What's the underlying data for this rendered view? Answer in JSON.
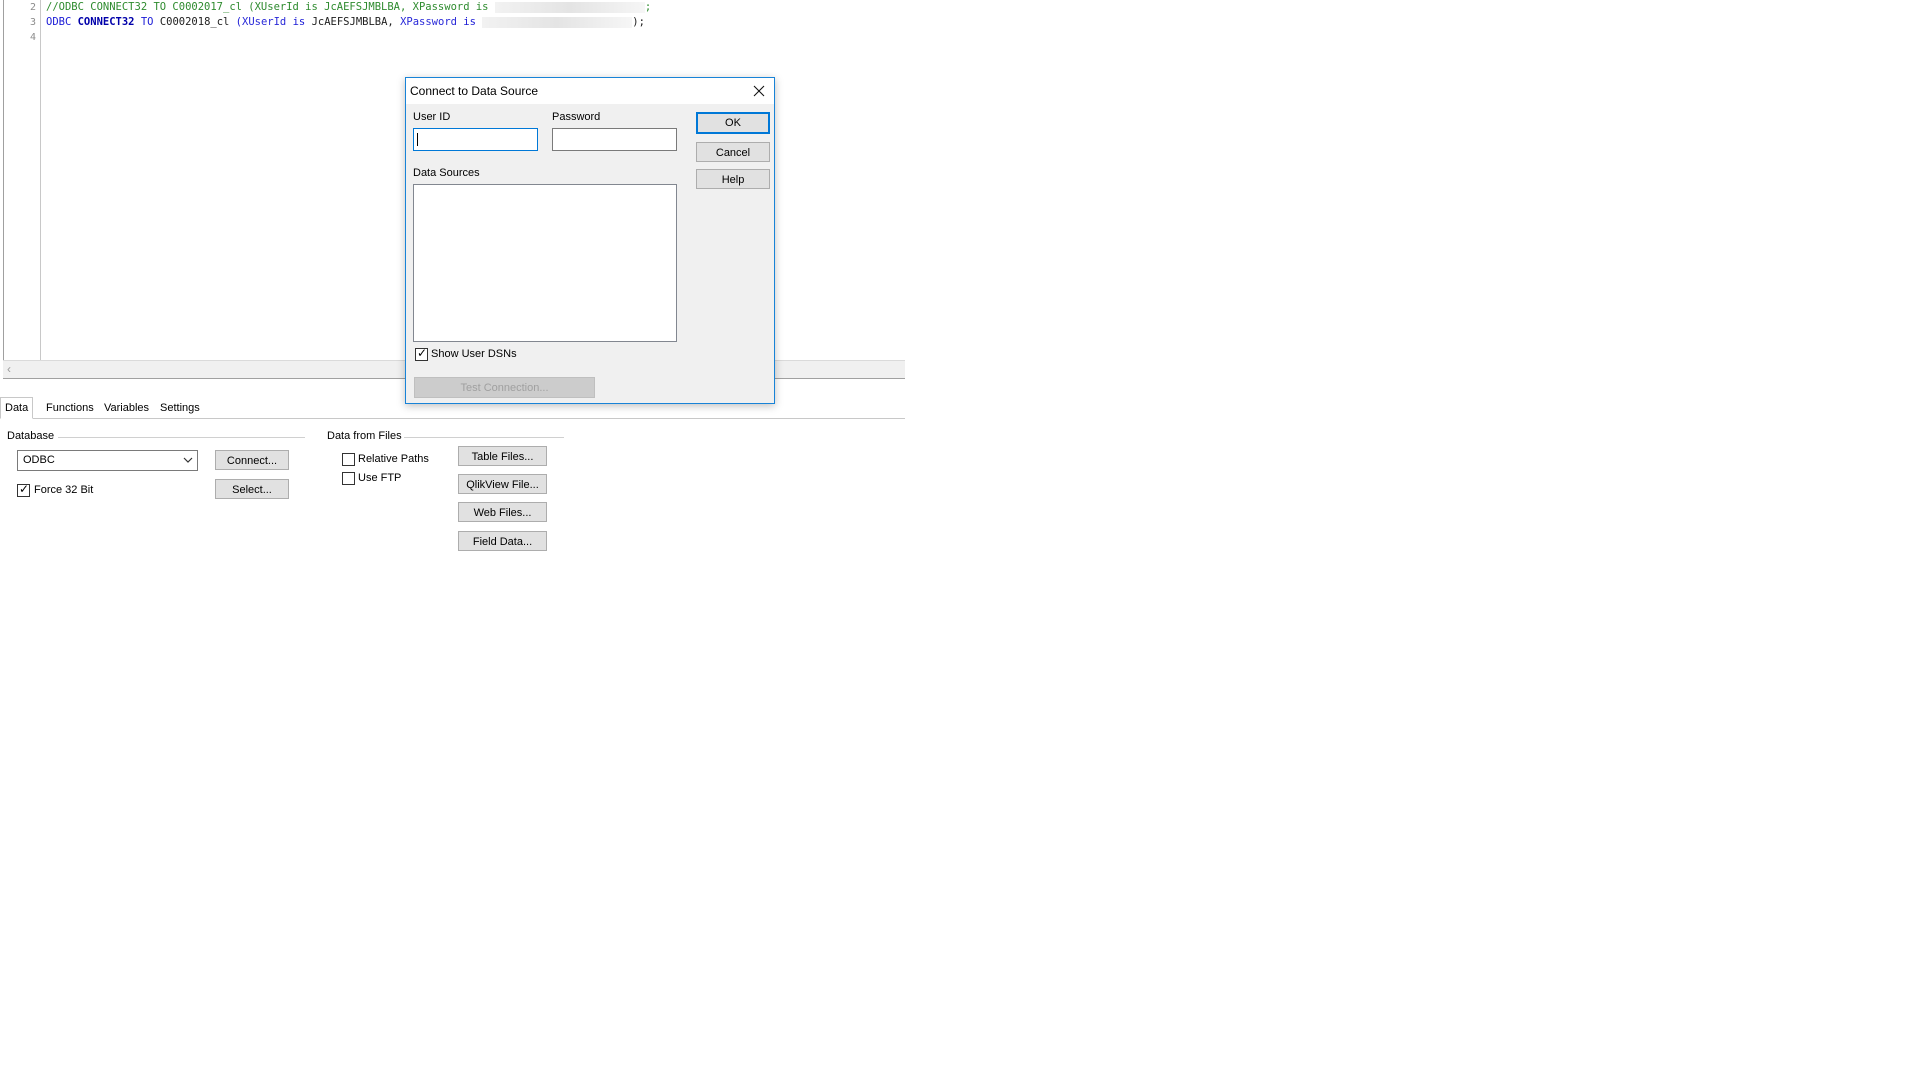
{
  "editor": {
    "lines": [
      {
        "num": "2",
        "segments": [
          {
            "text": "//ODBC CONNECT32 TO C0002017_cl (XUserId is JcAEFSJMBLBA, XPassword is ",
            "cls": "c-comment"
          },
          {
            "text": "",
            "cls": "blur",
            "redacted": true
          },
          {
            "text": ";",
            "cls": "c-comment"
          }
        ]
      },
      {
        "num": "3",
        "segments": [
          {
            "text": "ODBC ",
            "cls": "c-kw"
          },
          {
            "text": "CONNECT32",
            "cls": "c-kw2"
          },
          {
            "text": " TO ",
            "cls": "c-kw"
          },
          {
            "text": "C0002018_cl ",
            "cls": "c-plain"
          },
          {
            "text": "(",
            "cls": "c-kw"
          },
          {
            "text": "XUserId",
            "cls": "c-field"
          },
          {
            "text": " is ",
            "cls": "c-kw"
          },
          {
            "text": "JcAEFSJMBLBA, ",
            "cls": "c-plain"
          },
          {
            "text": "XPassword",
            "cls": "c-field"
          },
          {
            "text": " is ",
            "cls": "c-kw"
          },
          {
            "text": "",
            "cls": "blur",
            "redacted": true
          },
          {
            "text": ");",
            "cls": "c-plain"
          }
        ]
      },
      {
        "num": "4",
        "segments": []
      }
    ]
  },
  "tabs": [
    {
      "label": "Data",
      "active": true
    },
    {
      "label": "Functions",
      "active": false
    },
    {
      "label": "Variables",
      "active": false
    },
    {
      "label": "Settings",
      "active": false
    }
  ],
  "database": {
    "group_title": "Database",
    "select_value": "ODBC",
    "connect_label": "Connect...",
    "select_label": "Select...",
    "force32_label": "Force 32 Bit",
    "force32_checked": true
  },
  "files": {
    "group_title": "Data from Files",
    "relative_paths_label": "Relative Paths",
    "relative_paths_checked": false,
    "use_ftp_label": "Use FTP",
    "use_ftp_checked": false,
    "table_files_label": "Table Files...",
    "qlikview_file_label": "QlikView File...",
    "web_files_label": "Web Files...",
    "field_data_label": "Field Data..."
  },
  "dialog": {
    "title": "Connect to Data Source",
    "user_id_label": "User ID",
    "user_id_value": "",
    "password_label": "Password",
    "password_value": "",
    "data_sources_label": "Data Sources",
    "data_sources": [],
    "show_user_dsns_label": "Show User DSNs",
    "show_user_dsns_checked": true,
    "test_connection_label": "Test Connection...",
    "ok_label": "OK",
    "cancel_label": "Cancel",
    "help_label": "Help",
    "accent_color": "#0078d7"
  },
  "icons": {
    "close": "close-icon",
    "dropdown": "chevron-down-icon",
    "scroll_left": "chevron-left-icon",
    "check": "checkmark-icon"
  }
}
